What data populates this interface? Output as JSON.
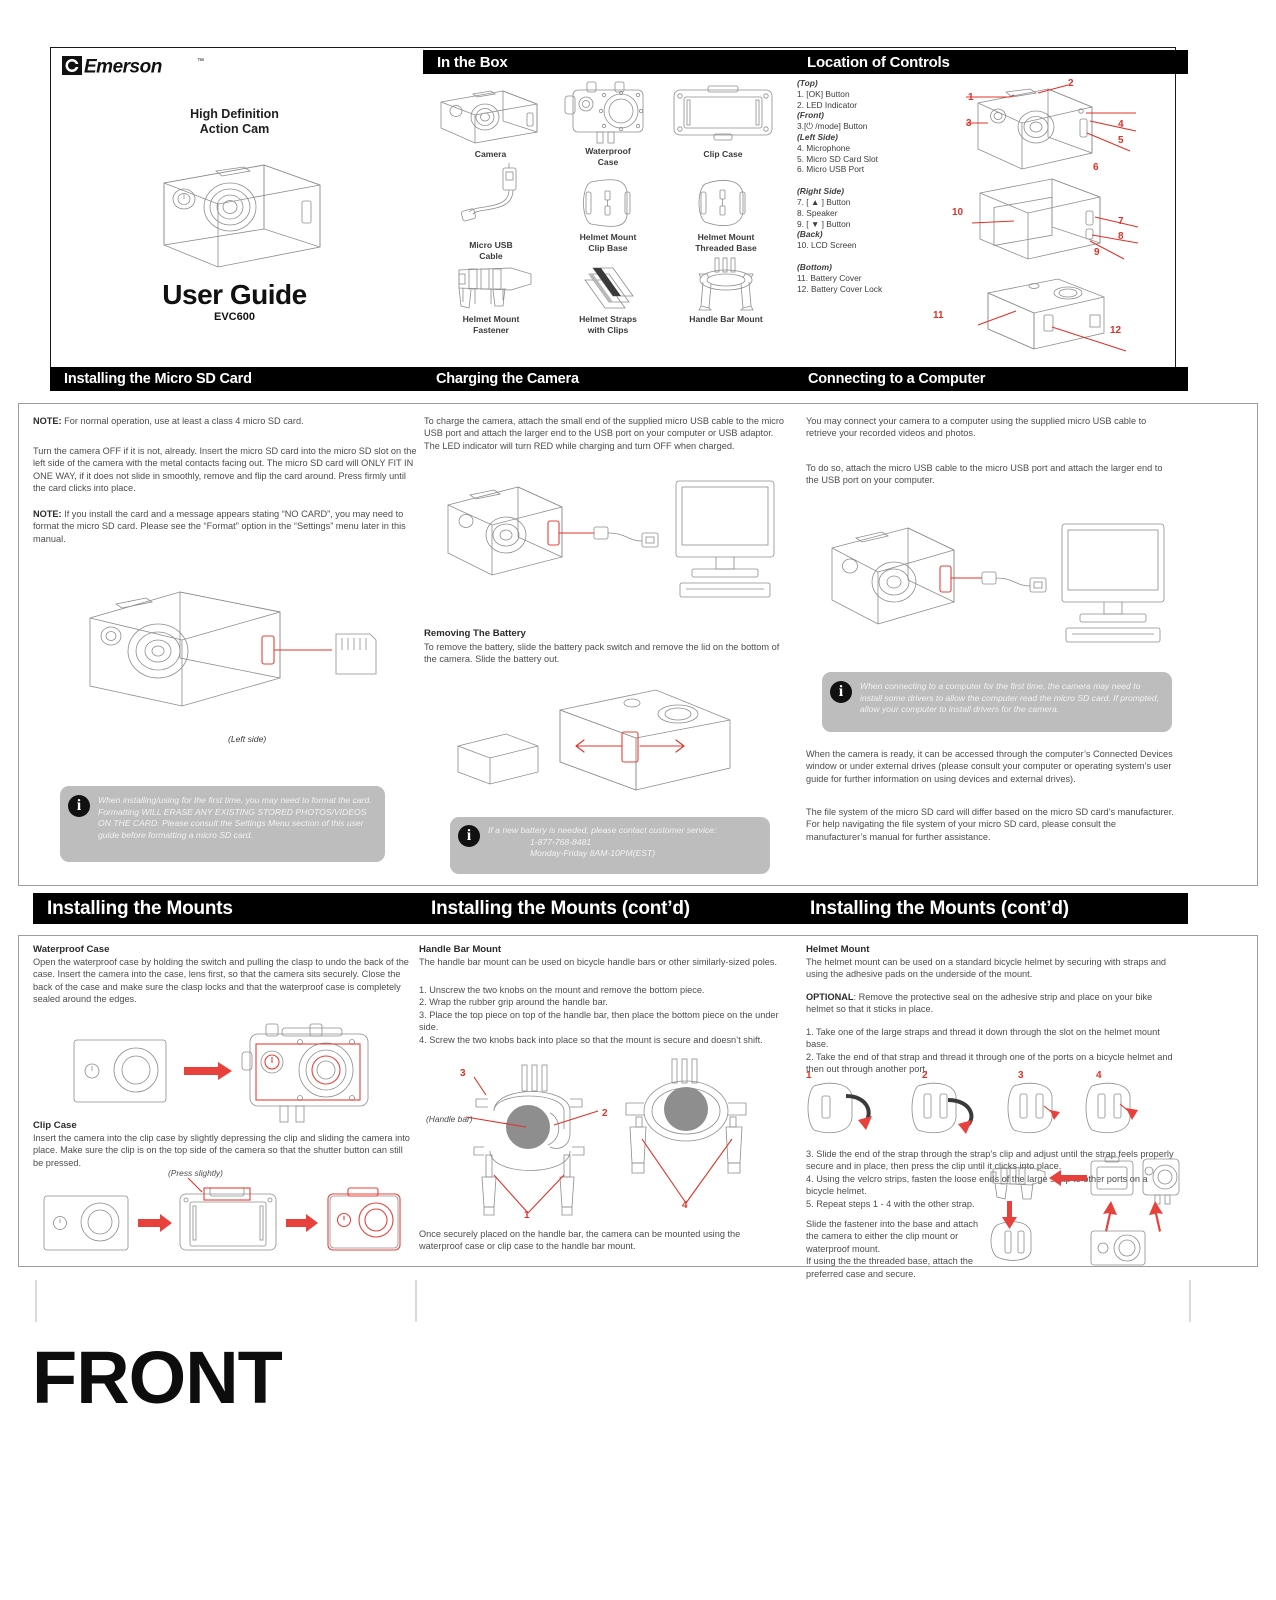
{
  "page": {
    "footer_label": "FRONT"
  },
  "cover": {
    "brand": "Emerson",
    "trademark": "™",
    "subtitle_line1": "High Definition",
    "subtitle_line2": "Action Cam",
    "title": "User Guide",
    "model": "EVC600"
  },
  "in_the_box": {
    "header": "In the Box",
    "items": [
      {
        "label": "Camera",
        "icon": "camera-icon"
      },
      {
        "label": "Waterproof\nCase",
        "icon": "waterproof-case-icon"
      },
      {
        "label": "Clip Case",
        "icon": "clip-case-icon"
      },
      {
        "label": "Micro USB\nCable",
        "icon": "usb-cable-icon"
      },
      {
        "label": "Helmet Mount\nClip Base",
        "icon": "helmet-clip-base-icon"
      },
      {
        "label": "Helmet Mount\nThreaded Base",
        "icon": "helmet-threaded-base-icon"
      },
      {
        "label": "Helmet Mount\nFastener",
        "icon": "helmet-fastener-icon"
      },
      {
        "label": "Helmet Straps\nwith Clips",
        "icon": "helmet-straps-icon"
      },
      {
        "label": "Handle Bar Mount",
        "icon": "handlebar-mount-icon"
      }
    ]
  },
  "location_of_controls": {
    "header": "Location of Controls",
    "groups": [
      {
        "side": "(Top)",
        "items": [
          "1. [OK] Button",
          "2. LED Indicator"
        ]
      },
      {
        "side": "(Front)",
        "items": [
          "3.[⏻ /mode] Button"
        ]
      },
      {
        "side": "(Left Side)",
        "items": [
          "4. Microphone",
          "5. Micro SD Card Slot",
          "6. Micro USB Port"
        ]
      },
      {
        "side": "(Right Side)",
        "items": [
          "7. [ ▲ ] Button",
          "8. Speaker",
          "9. [ ▼ ] Button"
        ]
      },
      {
        "side": "(Back)",
        "items": [
          "10. LCD Screen"
        ]
      },
      {
        "side": "(Bottom)",
        "items": [
          "11. Battery Cover",
          "12. Battery Cover Lock"
        ]
      }
    ],
    "callouts": [
      "1",
      "2",
      "3",
      "4",
      "5",
      "6",
      "7",
      "8",
      "9",
      "10",
      "11",
      "12"
    ]
  },
  "sd_card": {
    "header": "Installing the Micro SD Card",
    "note1_label": "NOTE:",
    "note1_text": " For normal operation, use at least a class 4 micro SD card.",
    "body1": "Turn the camera OFF if it is not, already. Insert the micro SD card into the micro SD slot on the left side of the camera with the metal contacts facing out. The micro SD card will ONLY FIT IN ONE WAY, if it does not slide in smoothly, remove and flip the card around. Press firmly until the card clicks into place.",
    "note2_label": "NOTE:",
    "note2_text": " If you install the card and a message appears stating “NO CARD”, you may need to format the micro SD card. Please see the “Format” option in  the “Settings” menu later in this manual.",
    "diagram_caption": "(Left side)",
    "infobox": "When installing/using for the first time, you may need to format the card. Formatting WILL ERASE ANY EXISTING STORED PHOTOS/VIDEOS ON THE CARD. Please consult the Settings Menu section of this user guide before formatting a micro SD card."
  },
  "charging": {
    "header": "Charging the Camera",
    "body": "To charge the camera, attach the small end of the supplied micro USB cable to the micro USB port and attach the larger end to the USB port on your computer or USB adaptor. The LED indicator will turn RED while charging and turn OFF when charged.",
    "battery_heading": "Removing The Battery",
    "battery_body": "To remove the battery, slide the battery pack switch and remove the lid on the bottom of the camera. Slide the battery out.",
    "infobox_line1": "If a new battery is needed, please contact customer service:",
    "infobox_line2": "1-877-768-8481",
    "infobox_line3": "Monday-Friday 8AM-10PM(EST)"
  },
  "connecting": {
    "header": "Connecting to a Computer",
    "body1": "You may connect your camera to a computer using the supplied micro USB cable to retrieve your recorded videos and photos.",
    "body2": "To do so, attach the micro USB cable to the micro USB port and attach the larger end to the USB port on your computer.",
    "infobox": "When connecting to a computer for the first time, the camera may need to install some drivers to allow the computer read the micro SD card. If prompted, allow your computer to install drivers for the camera.",
    "body3": "When the camera is ready, it can be accessed through the computer’s Connected Devices window or under external drives (please consult your computer or operating system’s user guide for further information on using devices and external drives).",
    "body4": "The file system of the micro SD card will differ based on the micro SD card’s manufacturer. For help navigating the file system of your micro SD card, please consult the manufacturer’s manual for further assistance."
  },
  "mounts_left": {
    "header": "Installing the Mounts",
    "waterproof_heading": "Waterproof Case",
    "waterproof_body": "Open the waterproof case by holding the switch and pulling the clasp to undo the  back of the case. Insert the camera into the case, lens first, so that the camera sits securely. Close the back of the case and make sure the clasp locks and that the waterproof case is completely sealed around the edges.",
    "clip_heading": "Clip Case",
    "clip_body": "Insert the camera into the clip case by slightly depressing the clip and sliding the camera into place. Make sure the clip is on the top side of the camera so that the shutter button can still be pressed.",
    "clip_diagram_caption": "(Press slightly)"
  },
  "mounts_mid": {
    "header": "Installing the Mounts (cont’d)",
    "heading": "Handle Bar Mount",
    "intro": "The handle bar mount can be used on bicycle handle bars or other similarly-sized poles.",
    "steps": [
      "1. Unscrew the two knobs on the mount and remove the bottom piece.",
      "2. Wrap the rubber grip around the handle bar.",
      "3. Place the top piece on top of the handle bar, then place the bottom piece on the under     side.",
      "4. Screw the two knobs back into place so that the mount is secure and doesn’t shift."
    ],
    "diagram_caption": "(Handle bar)",
    "diagram_callouts": [
      "1",
      "2",
      "3",
      "4"
    ],
    "footer": "Once securely placed on the handle bar, the camera can be mounted using the waterproof case or clip case to the handle bar mount."
  },
  "mounts_right": {
    "header": "Installing the Mounts (cont’d)",
    "heading": "Helmet Mount",
    "intro": "The helmet mount can be used on a standard bicycle helmet by securing with straps and using the adhesive pads on the underside of the mount.",
    "optional_label": "OPTIONAL",
    "optional_text": ": Remove the protective seal on the adhesive strip and place on your bike helmet so that it sticks in place.",
    "steps_a": [
      "1. Take one of the large straps  and thread it down through the slot on the helmet mount     base.",
      "2. Take the end of that strap and thread it through one of the ports on a bicycle helmet and     then out through another port."
    ],
    "strip_numbers": [
      "1",
      "2",
      "3",
      "4"
    ],
    "steps_b": [
      "3. Slide the end of the strap through the strap’s clip and adjust until the strap feels properly     secure and in place, then press the clip until it clicks into place.",
      "4. Using the velcro strips, fasten the loose ends of the large strap to other ports on a bicycle     helmet.",
      "5. Repeat steps 1 - 4 with the other strap."
    ],
    "footer": "Slide the fastener into the base and attach the camera to either the clip mount or waterproof mount.\nIf using the the threaded base, attach the preferred case and secure."
  }
}
